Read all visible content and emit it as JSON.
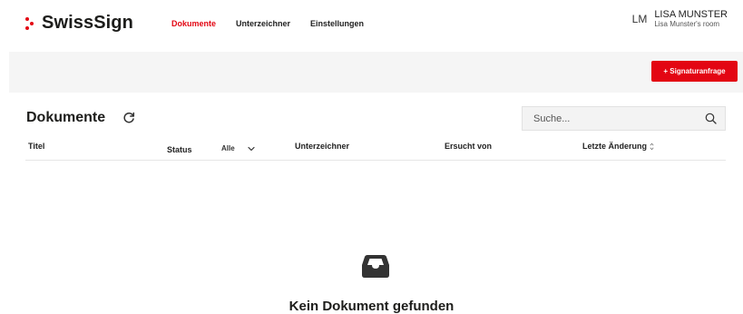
{
  "app": {
    "logo_text": "SwissSign",
    "brand_color": "#e30613"
  },
  "nav": {
    "items": [
      {
        "label": "Dokumente",
        "active": true
      },
      {
        "label": "Unterzeichner",
        "active": false
      },
      {
        "label": "Einstellungen",
        "active": false
      }
    ]
  },
  "user": {
    "initials": "LM",
    "name": "LISA MUNSTER",
    "room": "Lisa Munster's room"
  },
  "toolbar": {
    "new_request_label": "+ Signaturanfrage"
  },
  "documents": {
    "title": "Dokumente",
    "refresh_icon": "refresh-icon",
    "search": {
      "placeholder": "Suche...",
      "value": ""
    },
    "columns": {
      "title": "Titel",
      "status": "Status",
      "status_filter_value": "Alle",
      "signer": "Unterzeichner",
      "requested_by": "Ersucht von",
      "last_modified": "Letzte Änderung"
    },
    "rows": [],
    "empty_state": {
      "icon": "inbox-icon",
      "message": "Kein Dokument gefunden"
    }
  }
}
